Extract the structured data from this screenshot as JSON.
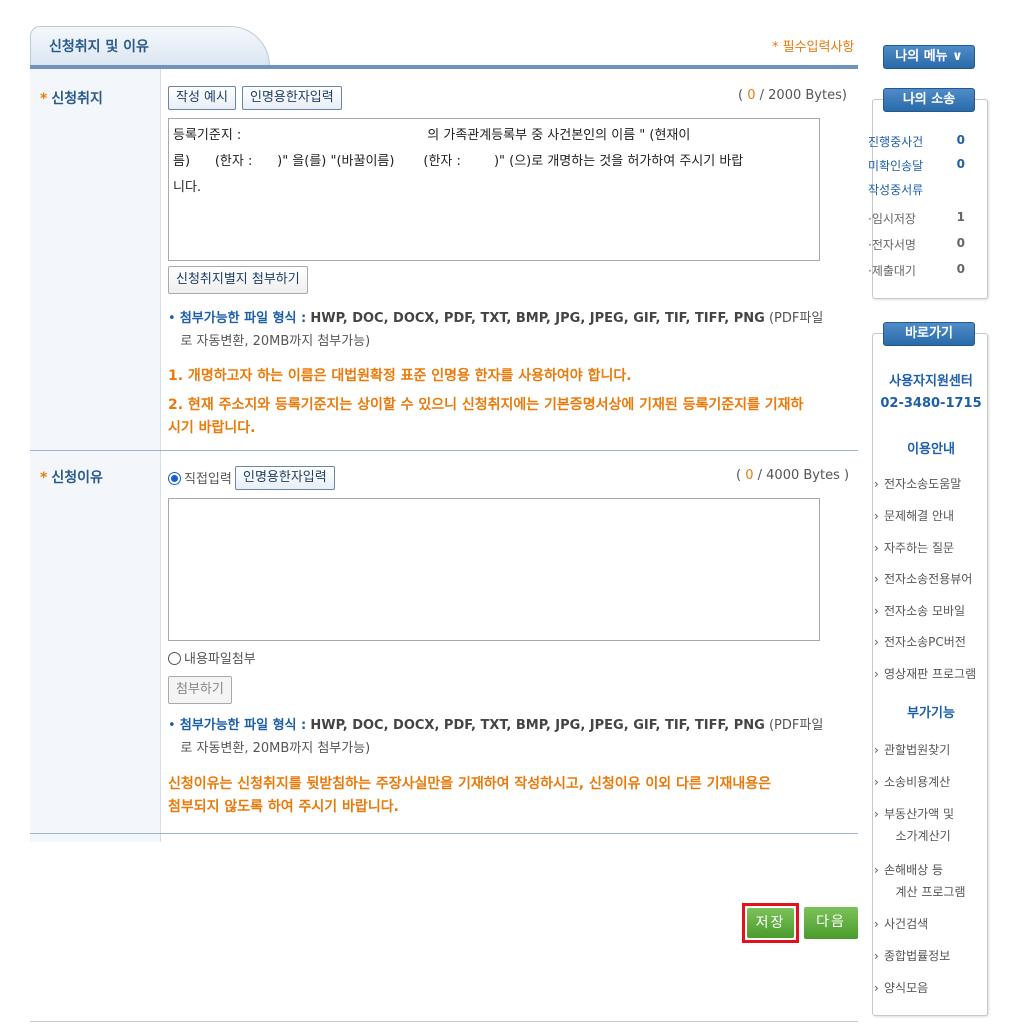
{
  "form": {
    "title": "신청취지 및 이유",
    "required_note": "* 필수입력사항",
    "purpose": {
      "label": "신청취지",
      "example_button": "작성 예시",
      "hanja_button": "인명용한자입력",
      "bytes_count": "0",
      "bytes_max": "/ 2000 Bytes)",
      "bytes_open": "(",
      "text_lines": [
        "등록기준지 :                                             의 가족관계등록부 중 사건본인의 이름 \" (현재이",
        "름)      (한자 :      )\" 을(를) \"(바꿀이름)       (한자 :        )\" (으)로 개명하는 것을 허가하여 주시기 바랍",
        "니다."
      ],
      "attach_button": "신청취지별지 첨부하기",
      "formats_label": "첨부가능한 파일 형식 :",
      "formats": "HWP, DOC, DOCX, PDF, TXT, BMP, JPG, JPEG, GIF, TIF, TIFF, PNG",
      "formats_suffix": "(PDF파일",
      "formats_line2": "로 자동변환, 20MB까지 첨부가능)",
      "warning1": "1. 개명하고자 하는 이름은 대법원확정 표준 인명용 한자를 사용하여야 합니다.",
      "warning2_line1": "2. 현재 주소지와 등록기준지는 상이할 수 있으니 신청취지에는 기본증명서상에 기재된 등록기준지를 기재하",
      "warning2_line2": "시기 바랍니다."
    },
    "reason": {
      "label": "신청이유",
      "direct_input": "직접입력",
      "hanja_button": "인명용한자입력",
      "bytes_open": "(",
      "bytes_count": "0",
      "bytes_max": "/ 4000 Bytes )",
      "text": "",
      "file_option": "내용파일첨부",
      "attach_button": "첨부하기",
      "formats_label": "첨부가능한 파일 형식 :",
      "formats": "HWP, DOC, DOCX, PDF, TXT, BMP, JPG, JPEG, GIF, TIF, TIFF, PNG",
      "formats_suffix": "(PDF파일",
      "formats_line2": "로 자동변환, 20MB까지 첨부가능)",
      "warning_line1": "신청이유는 신청취지를 뒷받침하는 주장사실만을 기재하여 작성하시고, 신청이유 이외 다른 기재내용은",
      "warning_line2": "첨부되지 않도록 하여 주시기 바랍니다."
    },
    "save_button": "저장",
    "next_button": "다음"
  },
  "sidebar": {
    "my_menu": "나의 메뉴 ∨",
    "my_case": "나의 소송",
    "stats": [
      {
        "label": "진행중사건",
        "value": "0"
      },
      {
        "label": "미확인송달",
        "value": "0"
      },
      {
        "label": "작성중서류",
        "value": ""
      },
      {
        "label": "·임시저장",
        "value": "1"
      },
      {
        "label": "·전자서명",
        "value": "0"
      },
      {
        "label": "·제출대기",
        "value": "0"
      }
    ],
    "shortcut": "바로가기",
    "support_center": "사용자지원센터",
    "support_phone": "02-3480-1715",
    "guide_title": "이용안내",
    "guide_links": [
      "전자소송도움말",
      "문제해결 안내",
      "자주하는 질문",
      "전자소송전용뷰어",
      "전자소송 모바일",
      "전자소송PC버전",
      "영상재판 프로그램"
    ],
    "extra_title": "부가기능",
    "extra_links": [
      "관할법원찾기",
      "소송비용계산",
      "부동산가액 및",
      "소가계산기",
      "손해배상 등",
      "계산 프로그램",
      "사건검색",
      "종합법률정보",
      "양식모음"
    ]
  }
}
